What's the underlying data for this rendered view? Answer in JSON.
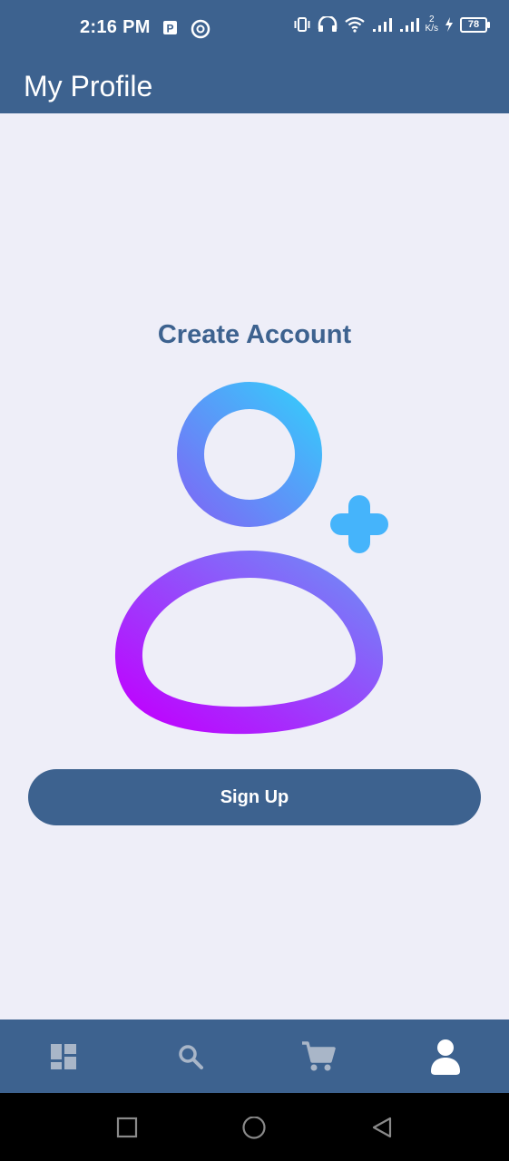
{
  "status_bar": {
    "time": "2:16 PM",
    "network_speed_value": "2",
    "network_speed_unit": "K/s",
    "battery_level": "78"
  },
  "app_bar": {
    "title": "My Profile"
  },
  "main": {
    "heading": "Create Account",
    "illustration_icon": "user-add-icon",
    "signup_label": "Sign Up"
  },
  "bottom_nav": {
    "items": [
      {
        "icon": "dashboard-icon",
        "active": false
      },
      {
        "icon": "search-icon",
        "active": false
      },
      {
        "icon": "cart-icon",
        "active": false
      },
      {
        "icon": "profile-icon",
        "active": true
      }
    ]
  },
  "system_nav": {
    "items": [
      "recents-icon",
      "home-icon",
      "back-icon"
    ]
  },
  "colors": {
    "primary": "#3d628f",
    "background": "#eeeef8",
    "gradient_start": "#c000ff",
    "gradient_end": "#38c8fb",
    "inactive_nav": "#a9b6c8"
  }
}
